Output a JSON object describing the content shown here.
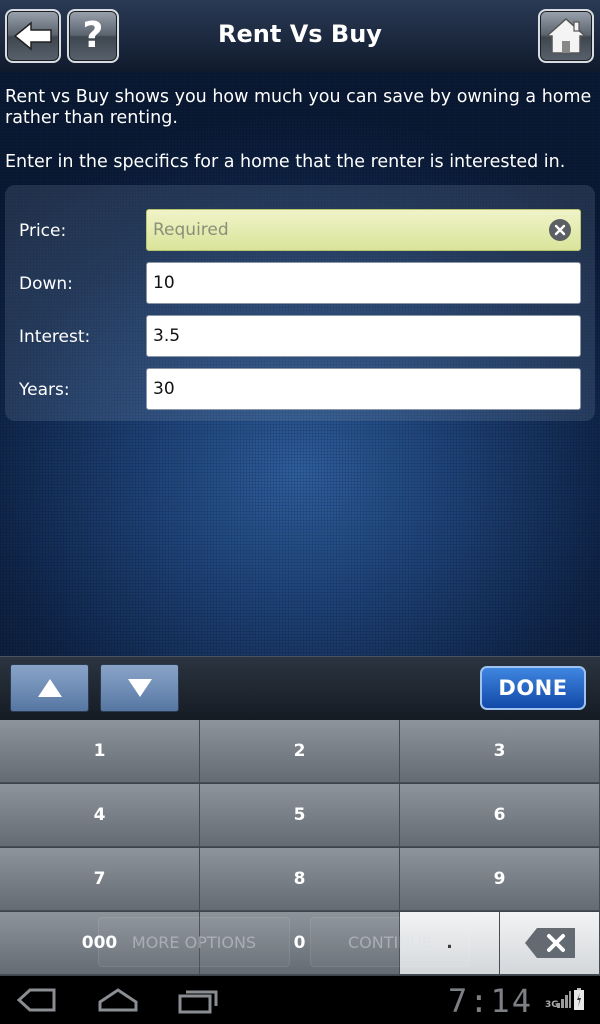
{
  "header": {
    "title": "Rent Vs Buy",
    "help_label": "?"
  },
  "intro": {
    "line1": "Rent vs Buy shows you how much you can save by owning a home rather than renting.",
    "line2": "Enter in the specifics for a home that the renter is interested in."
  },
  "form": {
    "price": {
      "label": "Price:",
      "value": "",
      "placeholder": "Required"
    },
    "down": {
      "label": "Down:",
      "value": "10"
    },
    "interest": {
      "label": "Interest:",
      "value": "3.5"
    },
    "years": {
      "label": "Years:",
      "value": "30"
    }
  },
  "keyboard_toolbar": {
    "done_label": "DONE"
  },
  "keypad": {
    "keys": [
      "1",
      "2",
      "3",
      "4",
      "5",
      "6",
      "7",
      "8",
      "9",
      "000",
      "0",
      "."
    ],
    "ghost_more": "MORE OPTIONS",
    "ghost_continue": "CONTINUE"
  },
  "status_bar": {
    "time": "7:14",
    "network": "3G"
  },
  "colors": {
    "done_blue": "#1f5fc4",
    "active_field": "#dbe59e",
    "arrow_button": "#6a89b3"
  },
  "icons": [
    "back-arrow-icon",
    "question-icon",
    "home-icon",
    "clear-icon",
    "up-arrow-icon",
    "down-arrow-icon",
    "backspace-icon",
    "nav-back-icon",
    "nav-home-icon",
    "nav-recent-icon",
    "signal-icon",
    "battery-icon"
  ]
}
